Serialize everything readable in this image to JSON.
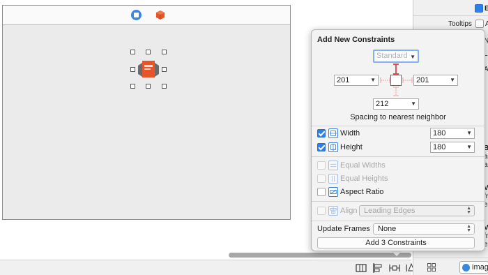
{
  "popover": {
    "title": "Add New Constraints",
    "top": {
      "placeholder": "Standard",
      "value": ""
    },
    "left": {
      "value": "201"
    },
    "right": {
      "value": "201"
    },
    "bottom": {
      "value": "212"
    },
    "spacing_label": "Spacing to nearest neighbor",
    "rows": {
      "width": {
        "label": "Width",
        "checked": true,
        "value": "180"
      },
      "height": {
        "label": "Height",
        "checked": true,
        "value": "180"
      },
      "equal_widths": {
        "label": "Equal Widths",
        "checked": false,
        "enabled": false
      },
      "equal_heights": {
        "label": "Equal Heights",
        "checked": false,
        "enabled": false
      },
      "aspect_ratio": {
        "label": "Aspect Ratio",
        "checked": false,
        "enabled": true
      },
      "align": {
        "label": "Align",
        "value": "Leading Edges",
        "enabled": false
      }
    },
    "update_frames": {
      "label": "Update Frames",
      "value": "None"
    },
    "add_button": "Add 3 Constraints"
  },
  "inspector": {
    "tooltips_label": "Tooltips",
    "tooltips_checkbox_label": "A",
    "partial_labels": [
      "Na",
      "Le",
      "Au"
    ],
    "partial_b": "B",
    "partial_b_lines": [
      "ac",
      "ag"
    ],
    "partial_v1": "V",
    "partial_v1_lines": [
      "fro",
      "e."
    ],
    "partial_v2": "V",
    "partial_v2_lines": [
      "fro",
      "e."
    ],
    "image_button_label": "image"
  },
  "colors": {
    "accent": "#2f7fe8",
    "constraint_red": "#e0505a",
    "app_icon": "#e8542a"
  }
}
